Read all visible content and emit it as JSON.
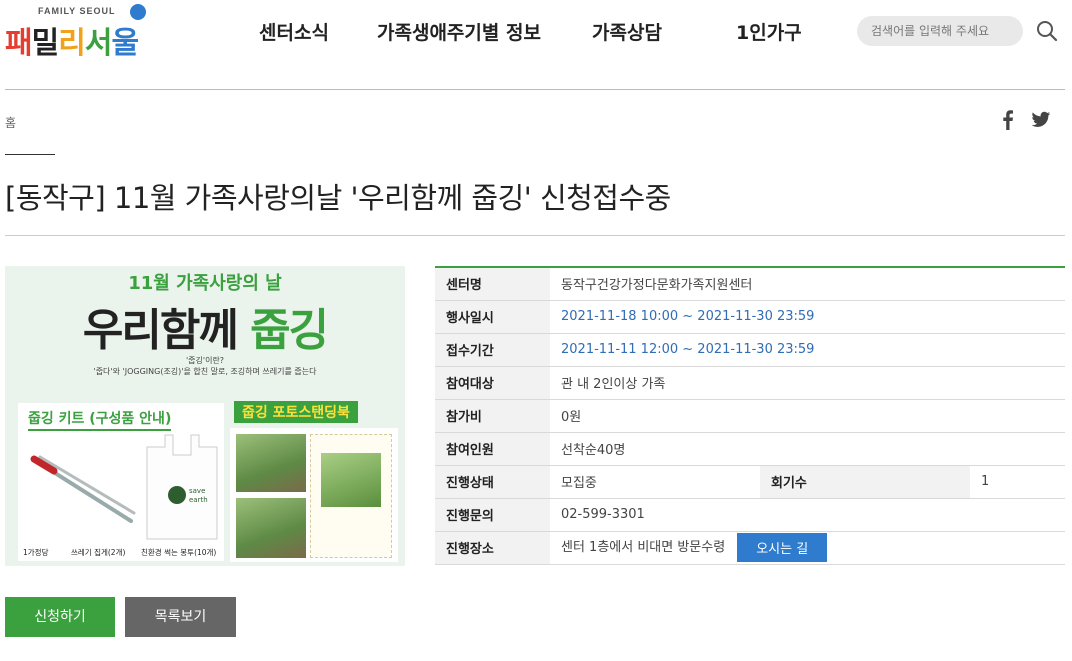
{
  "logo": {
    "small_text": "FAMILY SEOUL",
    "main_chars": [
      "패",
      "밀",
      "리",
      "서",
      "울"
    ]
  },
  "nav": {
    "items": [
      "센터소식",
      "가족생애주기별 정보",
      "가족상담",
      "1인가구"
    ]
  },
  "search": {
    "placeholder": "검색어를 입력해 주세요"
  },
  "breadcrumb": {
    "home": "홈"
  },
  "page": {
    "title": "[동작구] 11월 가족사랑의날 '우리함께 줍깅' 신청접수중"
  },
  "poster": {
    "subtitle": "11월 가족사랑의 날",
    "title_plain": "우리함께 ",
    "title_green": "줍깅",
    "question": "'줍깅'이란?",
    "description": "'줍다'와 'JOGGING(조깅)'을 합친 말로, 조깅하며 쓰레기를 줍는다",
    "kit_title": "줍깅 키트 (구성품 안내)",
    "kit_labels": [
      "1가정당",
      "쓰레기 집게(2개)",
      "친환경 썩는 봉투(10개)"
    ],
    "photo_title": "줍깅 포토스탠딩북"
  },
  "info": {
    "rows": [
      {
        "label": "센터명",
        "value": "동작구건강가정다문화가족지원센터"
      },
      {
        "label": "행사일시",
        "value": "2021-11-18 10:00 ~ 2021-11-30 23:59"
      },
      {
        "label": "접수기간",
        "value": "2021-11-11 12:00 ~ 2021-11-30 23:59"
      },
      {
        "label": "참여대상",
        "value": "관 내 2인이상 가족"
      },
      {
        "label": "참가비",
        "value": "0원"
      },
      {
        "label": "참여인원",
        "value": "선착순40명"
      },
      {
        "label": "진행상태",
        "value": "모집중",
        "label2": "회기수",
        "value2": "1"
      },
      {
        "label": "진행문의",
        "value": "02-599-3301"
      },
      {
        "label": "진행장소",
        "value": "센터 1층에서 비대면 방문수령",
        "button": "오시는 길"
      }
    ]
  },
  "actions": {
    "apply": "신청하기",
    "list": "목록보기"
  },
  "colors": {
    "brand_green": "#3aa13e",
    "link_blue": "#2f6db5",
    "button_blue": "#2f7ccf",
    "gray_button": "#666666"
  }
}
